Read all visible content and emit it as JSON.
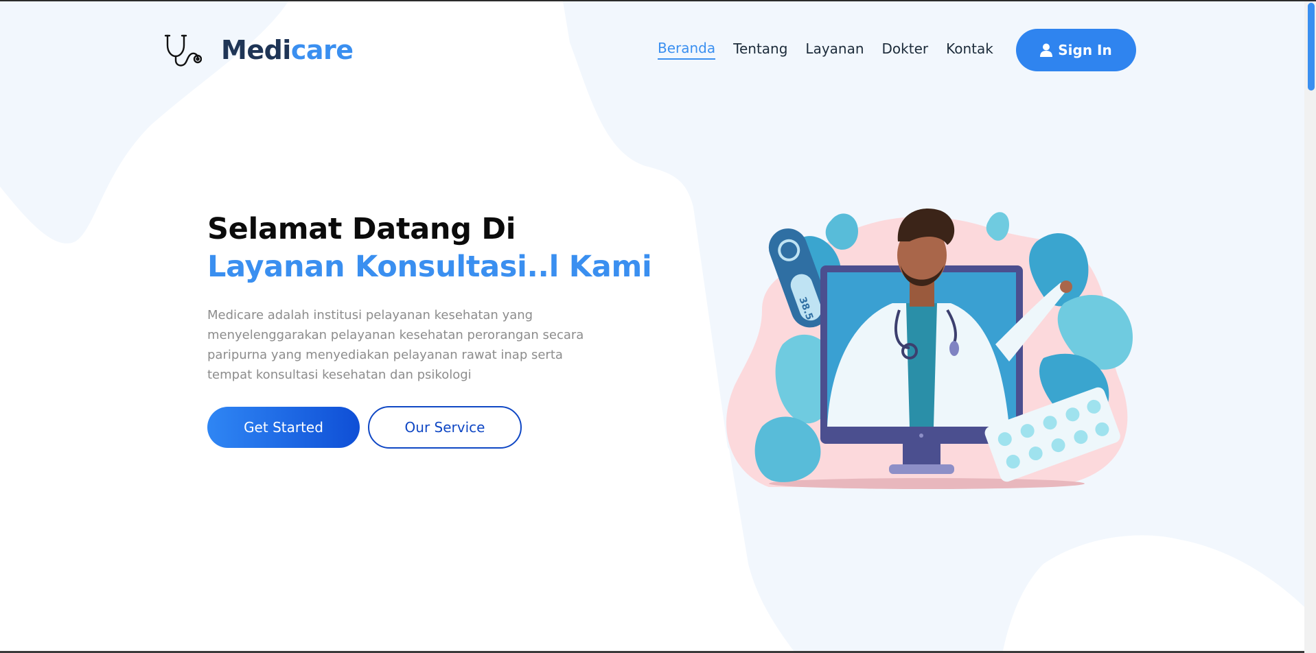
{
  "brand": {
    "name_part1": "Medi",
    "name_part2": "care",
    "accent": "#3a8ff0",
    "dark": "#1f3556"
  },
  "nav": {
    "items": [
      {
        "label": "Beranda",
        "active": true
      },
      {
        "label": "Tentang",
        "active": false
      },
      {
        "label": "Layanan",
        "active": false
      },
      {
        "label": "Dokter",
        "active": false
      },
      {
        "label": "Kontak",
        "active": false
      }
    ],
    "signin_label": "Sign In",
    "signin_icon": "user-icon"
  },
  "hero": {
    "title_line1": "Selamat Datang Di",
    "title_line2": "Layanan Konsultasi..l Kami",
    "description": "Medicare adalah institusi pelayanan kesehatan yang menyelenggarakan pelayanan kesehatan perorangan secara paripurna yang menyediakan pelayanan rawat inap serta tempat konsultasi kesehatan dan psikologi",
    "primary_cta": "Get Started",
    "secondary_cta": "Our Service",
    "illustration": "doctor-on-monitor-illustration",
    "thermometer_reading": "38.5"
  },
  "colors": {
    "background_blob": "#f2f7fd",
    "primary_button_start": "#2f86f4",
    "primary_button_end": "#0f4fd6",
    "outline_button": "#0f47c4"
  }
}
